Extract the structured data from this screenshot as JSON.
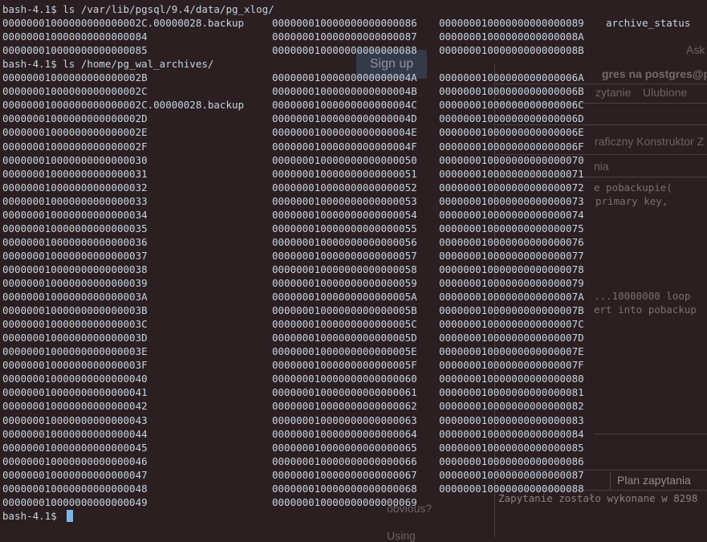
{
  "terminal": {
    "lines": [
      {
        "prompt": "bash-4.1$",
        "command": "ls /var/lib/pgsql/9.4/data/pg_xlog/"
      },
      {
        "cols": [
          "00000001000000000000002C.00000028.backup",
          "000000010000000000000086",
          "000000010000000000000089",
          "archive_status"
        ]
      },
      {
        "cols": [
          "000000010000000000000084",
          "000000010000000000000087",
          "00000001000000000000008A"
        ]
      },
      {
        "cols": [
          "000000010000000000000085",
          "000000010000000000000088",
          "00000001000000000000008B"
        ]
      },
      {
        "prompt": "bash-4.1$",
        "command": "ls /home/pg_wal_archives/"
      },
      {
        "cols": [
          "00000001000000000000002B",
          "00000001000000000000004A",
          "00000001000000000000006A"
        ]
      },
      {
        "cols": [
          "00000001000000000000002C",
          "00000001000000000000004B",
          "00000001000000000000006B"
        ]
      },
      {
        "cols": [
          "00000001000000000000002C.00000028.backup",
          "00000001000000000000004C",
          "00000001000000000000006C"
        ]
      },
      {
        "cols": [
          "00000001000000000000002D",
          "00000001000000000000004D",
          "00000001000000000000006D"
        ]
      },
      {
        "cols": [
          "00000001000000000000002E",
          "00000001000000000000004E",
          "00000001000000000000006E"
        ]
      },
      {
        "cols": [
          "00000001000000000000002F",
          "00000001000000000000004F",
          "00000001000000000000006F"
        ]
      },
      {
        "cols": [
          "000000010000000000000030",
          "000000010000000000000050",
          "000000010000000000000070"
        ]
      },
      {
        "cols": [
          "000000010000000000000031",
          "000000010000000000000051",
          "000000010000000000000071"
        ]
      },
      {
        "cols": [
          "000000010000000000000032",
          "000000010000000000000052",
          "000000010000000000000072"
        ]
      },
      {
        "cols": [
          "000000010000000000000033",
          "000000010000000000000053",
          "000000010000000000000073"
        ]
      },
      {
        "cols": [
          "000000010000000000000034",
          "000000010000000000000054",
          "000000010000000000000074"
        ]
      },
      {
        "cols": [
          "000000010000000000000035",
          "000000010000000000000055",
          "000000010000000000000075"
        ]
      },
      {
        "cols": [
          "000000010000000000000036",
          "000000010000000000000056",
          "000000010000000000000076"
        ]
      },
      {
        "cols": [
          "000000010000000000000037",
          "000000010000000000000057",
          "000000010000000000000077"
        ]
      },
      {
        "cols": [
          "000000010000000000000038",
          "000000010000000000000058",
          "000000010000000000000078"
        ]
      },
      {
        "cols": [
          "000000010000000000000039",
          "000000010000000000000059",
          "000000010000000000000079"
        ]
      },
      {
        "cols": [
          "00000001000000000000003A",
          "00000001000000000000005A",
          "00000001000000000000007A"
        ]
      },
      {
        "cols": [
          "00000001000000000000003B",
          "00000001000000000000005B",
          "00000001000000000000007B"
        ]
      },
      {
        "cols": [
          "00000001000000000000003C",
          "00000001000000000000005C",
          "00000001000000000000007C"
        ]
      },
      {
        "cols": [
          "00000001000000000000003D",
          "00000001000000000000005D",
          "00000001000000000000007D"
        ]
      },
      {
        "cols": [
          "00000001000000000000003E",
          "00000001000000000000005E",
          "00000001000000000000007E"
        ]
      },
      {
        "cols": [
          "00000001000000000000003F",
          "00000001000000000000005F",
          "00000001000000000000007F"
        ]
      },
      {
        "cols": [
          "000000010000000000000040",
          "000000010000000000000060",
          "000000010000000000000080"
        ]
      },
      {
        "cols": [
          "000000010000000000000041",
          "000000010000000000000061",
          "000000010000000000000081"
        ]
      },
      {
        "cols": [
          "000000010000000000000042",
          "000000010000000000000062",
          "000000010000000000000082"
        ]
      },
      {
        "cols": [
          "000000010000000000000043",
          "000000010000000000000063",
          "000000010000000000000083"
        ]
      },
      {
        "cols": [
          "000000010000000000000044",
          "000000010000000000000064",
          "000000010000000000000084"
        ]
      },
      {
        "cols": [
          "000000010000000000000045",
          "000000010000000000000065",
          "000000010000000000000085"
        ]
      },
      {
        "cols": [
          "000000010000000000000046",
          "000000010000000000000066",
          "000000010000000000000086"
        ]
      },
      {
        "cols": [
          "000000010000000000000047",
          "000000010000000000000067",
          "000000010000000000000087"
        ]
      },
      {
        "cols": [
          "000000010000000000000048",
          "000000010000000000000068",
          "000000010000000000000088"
        ]
      },
      {
        "cols": [
          "000000010000000000000049",
          "000000010000000000000069"
        ]
      },
      {
        "prompt": "bash-4.1$",
        "command": ""
      }
    ]
  },
  "background": {
    "signup_label": "Sign up",
    "ask_label": "Ask",
    "window_title_fragment": "gres na postgres@p",
    "menu_items": [
      "zytanie",
      "Ulubione"
    ],
    "tab_fragment": "raficzny Konstruktor Z",
    "subtab_fragment": "nia",
    "sql_lines": [
      "e pobackupie(",
      "primary key,",
      "...10000000 loop",
      "ert into pobackup"
    ],
    "plan_tab": "Plan zapytania",
    "status_message": "Zapytanie zostało wykonane w 8298",
    "obvious_text": "obvious?",
    "using_text": "Using"
  },
  "colors": {
    "terminal_bg": "#2b1f22",
    "terminal_text": "#c7d4e1",
    "cursor": "#7fb5e6"
  }
}
